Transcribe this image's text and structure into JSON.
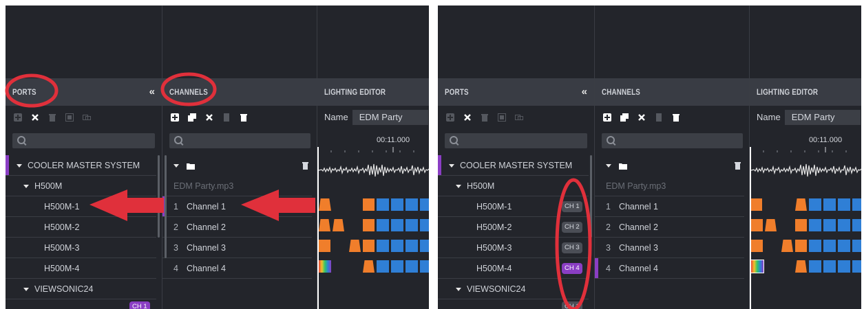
{
  "colors": {
    "accent": "#8a3ec4",
    "annotation": "#e0303b",
    "orange": "#f07e2b",
    "blue": "#2f7fd6",
    "panel_bg": "#23252b",
    "header_bg": "#393c44"
  },
  "panels": {
    "ports_title": "PORTS",
    "channels_title": "CHANNELS",
    "lighting_title": "LIGHTING EDITOR",
    "collapse_icon": "«"
  },
  "ports_tools": [
    "add-icon",
    "close-icon",
    "trash-icon",
    "image-icon",
    "duplicate-icon"
  ],
  "channels_tools": [
    "add-icon",
    "copy-icon",
    "close-icon",
    "file-icon",
    "trash-icon"
  ],
  "ports": {
    "group": "COOLER MASTER SYSTEM",
    "device": "H500M",
    "items": [
      {
        "label": "H500M-1",
        "badge": "CH 1"
      },
      {
        "label": "H500M-2",
        "badge": "CH 2"
      },
      {
        "label": "H500M-3",
        "badge": "CH 3"
      },
      {
        "label": "H500M-4",
        "badge": "CH 4"
      }
    ],
    "device2": "VIEWSONIC24",
    "partial_badge": "CH 1"
  },
  "channels": {
    "file": "EDM Party.mp3",
    "items": [
      {
        "num": "1",
        "label": "Channel 1"
      },
      {
        "num": "2",
        "label": "Channel 2"
      },
      {
        "num": "3",
        "label": "Channel 3"
      },
      {
        "num": "4",
        "label": "Channel 4"
      }
    ]
  },
  "lighting": {
    "name_label": "Name",
    "name_value": "EDM Party",
    "time": "00:11.000"
  }
}
